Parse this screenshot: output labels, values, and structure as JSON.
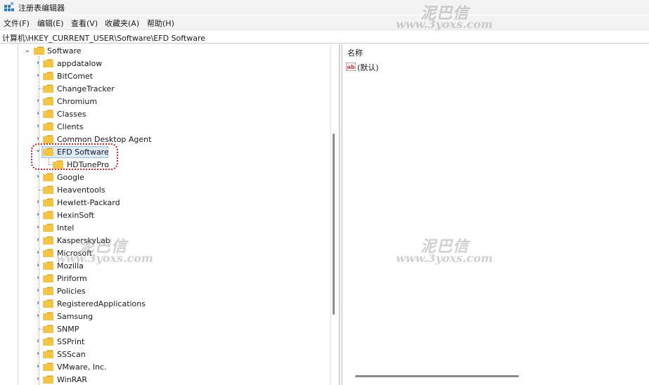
{
  "window": {
    "title": "注册表编辑器",
    "icon": "registry-editor-icon"
  },
  "menu": [
    {
      "label": "文件(F)"
    },
    {
      "label": "编辑(E)"
    },
    {
      "label": "查看(V)"
    },
    {
      "label": "收藏夹(A)"
    },
    {
      "label": "帮助(H)"
    }
  ],
  "address": {
    "path": "计算机\\HKEY_CURRENT_USER\\Software\\EFD Software"
  },
  "tree": {
    "parent": {
      "label": "Software",
      "expanded": true
    },
    "items": [
      {
        "label": "appdatalow",
        "has_children": true
      },
      {
        "label": "BitComet",
        "has_children": true
      },
      {
        "label": "ChangeTracker",
        "has_children": false
      },
      {
        "label": "Chromium",
        "has_children": true
      },
      {
        "label": "Classes",
        "has_children": true
      },
      {
        "label": "Clients",
        "has_children": true
      },
      {
        "label": "Common Desktop Agent",
        "has_children": true
      },
      {
        "label": "EFD Software",
        "has_children": true,
        "expanded": true,
        "selected": true
      },
      {
        "label": "HDTunePro",
        "has_children": false,
        "child": true
      },
      {
        "label": "Google",
        "has_children": true
      },
      {
        "label": "Heaventools",
        "has_children": false
      },
      {
        "label": "Hewlett-Packard",
        "has_children": true
      },
      {
        "label": "HexinSoft",
        "has_children": true
      },
      {
        "label": "Intel",
        "has_children": true
      },
      {
        "label": "KasperskyLab",
        "has_children": true
      },
      {
        "label": "Microsoft",
        "has_children": true
      },
      {
        "label": "Mozilla",
        "has_children": true
      },
      {
        "label": "Piriform",
        "has_children": true
      },
      {
        "label": "Policies",
        "has_children": true
      },
      {
        "label": "RegisteredApplications",
        "has_children": true
      },
      {
        "label": "Samsung",
        "has_children": true
      },
      {
        "label": "SNMP",
        "has_children": false
      },
      {
        "label": "SSPrint",
        "has_children": true
      },
      {
        "label": "SSScan",
        "has_children": true
      },
      {
        "label": "VMware, Inc.",
        "has_children": true
      },
      {
        "label": "WinRAR",
        "has_children": true
      }
    ]
  },
  "values_pane": {
    "column_header": "名称",
    "rows": [
      {
        "icon": "string-value-icon",
        "name": "(默认)"
      }
    ]
  },
  "watermarks": [
    {
      "line1": "泥巴信",
      "line2": "www.3yoxs.com"
    }
  ],
  "colors": {
    "highlight": "#e0201e",
    "selection": "#dbe9f7",
    "folder": "#f5c542"
  }
}
